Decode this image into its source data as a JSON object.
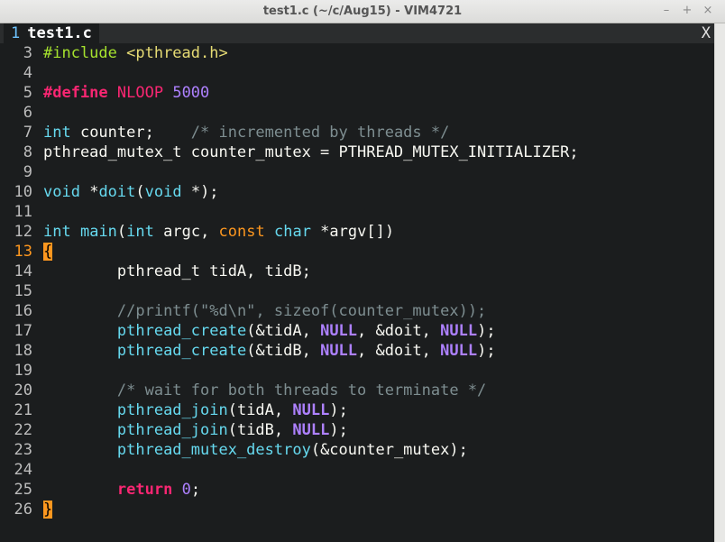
{
  "window": {
    "title": "test1.c (~/c/Aug15) - VIM4721",
    "minimize_glyph": "–",
    "maximize_glyph": "+",
    "close_glyph": "×"
  },
  "tabline": {
    "tab_number": "1",
    "tab_label": "test1.c",
    "close_label": "X"
  },
  "colors": {
    "background": "#1b1d1e",
    "preproc": "#a6e22e",
    "string": "#e6db74",
    "define": "#f92672",
    "number": "#ae81ff",
    "type": "#66d9ef",
    "comment": "#7e8e91",
    "keyword": "#fd971f"
  },
  "editor": {
    "cursor_line": "13",
    "lines": [
      {
        "num": "3",
        "tokens": [
          {
            "t": "#include ",
            "c": "preproc"
          },
          {
            "t": "<pthread.h>",
            "c": "str"
          }
        ]
      },
      {
        "num": "4",
        "tokens": []
      },
      {
        "num": "5",
        "tokens": [
          {
            "t": "#define ",
            "c": "define"
          },
          {
            "t": "NLOOP",
            "c": "macro"
          },
          {
            "t": " ",
            "c": "plain"
          },
          {
            "t": "5000",
            "c": "num"
          }
        ]
      },
      {
        "num": "6",
        "tokens": []
      },
      {
        "num": "7",
        "tokens": [
          {
            "t": "int",
            "c": "type"
          },
          {
            "t": " counter;    ",
            "c": "plain"
          },
          {
            "t": "/* incremented by threads */",
            "c": "comment"
          }
        ]
      },
      {
        "num": "8",
        "tokens": [
          {
            "t": "pthread_mutex_t counter_mutex = PTHREAD_MUTEX_INITIALIZER;",
            "c": "plain"
          }
        ]
      },
      {
        "num": "9",
        "tokens": []
      },
      {
        "num": "10",
        "tokens": [
          {
            "t": "void",
            "c": "type"
          },
          {
            "t": " *",
            "c": "plain"
          },
          {
            "t": "doit",
            "c": "func"
          },
          {
            "t": "(",
            "c": "plain"
          },
          {
            "t": "void",
            "c": "type"
          },
          {
            "t": " *);",
            "c": "plain"
          }
        ]
      },
      {
        "num": "11",
        "tokens": []
      },
      {
        "num": "12",
        "tokens": [
          {
            "t": "int",
            "c": "type"
          },
          {
            "t": " ",
            "c": "plain"
          },
          {
            "t": "main",
            "c": "func"
          },
          {
            "t": "(",
            "c": "plain"
          },
          {
            "t": "int",
            "c": "type"
          },
          {
            "t": " argc, ",
            "c": "plain"
          },
          {
            "t": "const",
            "c": "kw"
          },
          {
            "t": " ",
            "c": "plain"
          },
          {
            "t": "char",
            "c": "type"
          },
          {
            "t": " *argv[])",
            "c": "plain"
          }
        ]
      },
      {
        "num": "13",
        "tokens": [
          {
            "t": "{",
            "c": "brace"
          }
        ]
      },
      {
        "num": "14",
        "tokens": [
          {
            "t": "        pthread_t tidA, tidB;",
            "c": "plain"
          }
        ]
      },
      {
        "num": "15",
        "tokens": []
      },
      {
        "num": "16",
        "tokens": [
          {
            "t": "        ",
            "c": "plain"
          },
          {
            "t": "//printf(\"%d\\n\", sizeof(counter_mutex));",
            "c": "comment"
          }
        ]
      },
      {
        "num": "17",
        "tokens": [
          {
            "t": "        ",
            "c": "plain"
          },
          {
            "t": "pthread_create",
            "c": "func"
          },
          {
            "t": "(&tidA, ",
            "c": "plain"
          },
          {
            "t": "NULL",
            "c": "null"
          },
          {
            "t": ", &doit, ",
            "c": "plain"
          },
          {
            "t": "NULL",
            "c": "null"
          },
          {
            "t": ");",
            "c": "plain"
          }
        ]
      },
      {
        "num": "18",
        "tokens": [
          {
            "t": "        ",
            "c": "plain"
          },
          {
            "t": "pthread_create",
            "c": "func"
          },
          {
            "t": "(&tidB, ",
            "c": "plain"
          },
          {
            "t": "NULL",
            "c": "null"
          },
          {
            "t": ", &doit, ",
            "c": "plain"
          },
          {
            "t": "NULL",
            "c": "null"
          },
          {
            "t": ");",
            "c": "plain"
          }
        ]
      },
      {
        "num": "19",
        "tokens": []
      },
      {
        "num": "20",
        "tokens": [
          {
            "t": "        ",
            "c": "plain"
          },
          {
            "t": "/* wait for both threads to terminate */",
            "c": "comment"
          }
        ]
      },
      {
        "num": "21",
        "tokens": [
          {
            "t": "        ",
            "c": "plain"
          },
          {
            "t": "pthread_join",
            "c": "func"
          },
          {
            "t": "(tidA, ",
            "c": "plain"
          },
          {
            "t": "NULL",
            "c": "null"
          },
          {
            "t": ");",
            "c": "plain"
          }
        ]
      },
      {
        "num": "22",
        "tokens": [
          {
            "t": "        ",
            "c": "plain"
          },
          {
            "t": "pthread_join",
            "c": "func"
          },
          {
            "t": "(tidB, ",
            "c": "plain"
          },
          {
            "t": "NULL",
            "c": "null"
          },
          {
            "t": ");",
            "c": "plain"
          }
        ]
      },
      {
        "num": "23",
        "tokens": [
          {
            "t": "        ",
            "c": "plain"
          },
          {
            "t": "pthread_mutex_destroy",
            "c": "func"
          },
          {
            "t": "(&counter_mutex);",
            "c": "plain"
          }
        ]
      },
      {
        "num": "24",
        "tokens": []
      },
      {
        "num": "25",
        "tokens": [
          {
            "t": "        ",
            "c": "plain"
          },
          {
            "t": "return",
            "c": "ret"
          },
          {
            "t": " ",
            "c": "plain"
          },
          {
            "t": "0",
            "c": "num"
          },
          {
            "t": ";",
            "c": "plain"
          }
        ]
      },
      {
        "num": "26",
        "tokens": [
          {
            "t": "}",
            "c": "brace"
          }
        ]
      }
    ]
  }
}
